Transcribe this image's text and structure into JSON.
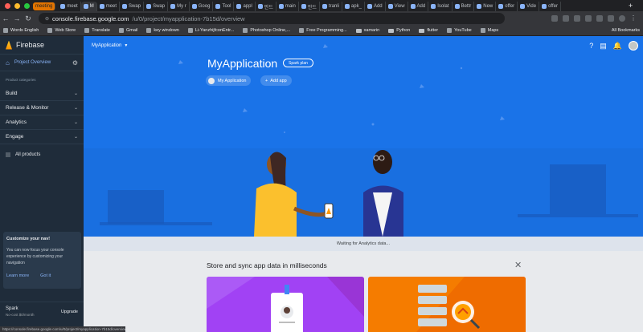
{
  "browser": {
    "tabs": [
      {
        "label": "meeting",
        "group": true
      },
      {
        "label": "meet"
      },
      {
        "label": "M",
        "active": true
      },
      {
        "label": "meet"
      },
      {
        "label": "Swap"
      },
      {
        "label": "Swap"
      },
      {
        "label": "My r"
      },
      {
        "label": "Goog"
      },
      {
        "label": "Tool"
      },
      {
        "label": "appl"
      },
      {
        "label": "안드"
      },
      {
        "label": "main"
      },
      {
        "label": "안드"
      },
      {
        "label": "tranli"
      },
      {
        "label": "apk_"
      },
      {
        "label": "Add"
      },
      {
        "label": "View"
      },
      {
        "label": "Add"
      },
      {
        "label": "Isolat"
      },
      {
        "label": "Bettr"
      },
      {
        "label": "New"
      },
      {
        "label": "offer"
      },
      {
        "label": "Vide"
      },
      {
        "label": "offer"
      }
    ],
    "new_tab": "+",
    "url_host": "console.firebase.google.com",
    "url_path": "/u/0/project/myapplication-7b15d/overview",
    "bookmarks": [
      {
        "label": "Words English"
      },
      {
        "label": "Web Store"
      },
      {
        "label": "Translate"
      },
      {
        "label": "Gmail"
      },
      {
        "label": "key windown"
      },
      {
        "label": "Li-YanzhijfconEntr..."
      },
      {
        "label": "Photoshop Online,..."
      },
      {
        "label": "Free Programming..."
      },
      {
        "label": "xamarin",
        "folder": true
      },
      {
        "label": "Python",
        "folder": true
      },
      {
        "label": "flutter",
        "folder": true
      },
      {
        "label": "YouTube"
      },
      {
        "label": "Maps"
      }
    ],
    "all_bookmarks": "All Bookmarks",
    "status_url": "https://console.firebase.google.com/u/0/project/myapplication-7b15d/overview"
  },
  "sidebar": {
    "brand": "Firebase",
    "project_overview": "Project Overview",
    "categories_heading": "Product categories",
    "categories": [
      "Build",
      "Release & Monitor",
      "Analytics",
      "Engage"
    ],
    "all_products": "All products",
    "customize": {
      "title": "Customize your nav!",
      "description": "You can now focus your console experience by customizing your navigation",
      "learn_more": "Learn more",
      "got_it": "Got it"
    },
    "plan": {
      "name": "Spark",
      "cost": "No-cost $0/month",
      "upgrade": "Upgrade"
    }
  },
  "main": {
    "project_selector": "MyApplication",
    "app_title": "MyApplication",
    "plan_chip": "Spark plan",
    "app_chip": "My Application",
    "add_app": "Add app",
    "analytics_status": "Waiting for Analytics data...",
    "store_heading": "Store and sync app data in milliseconds"
  },
  "colors": {
    "hero": "#1a73e8",
    "sidebar": "#1f2c3a",
    "card_purple": "#a142f4",
    "card_orange": "#f57c00"
  }
}
